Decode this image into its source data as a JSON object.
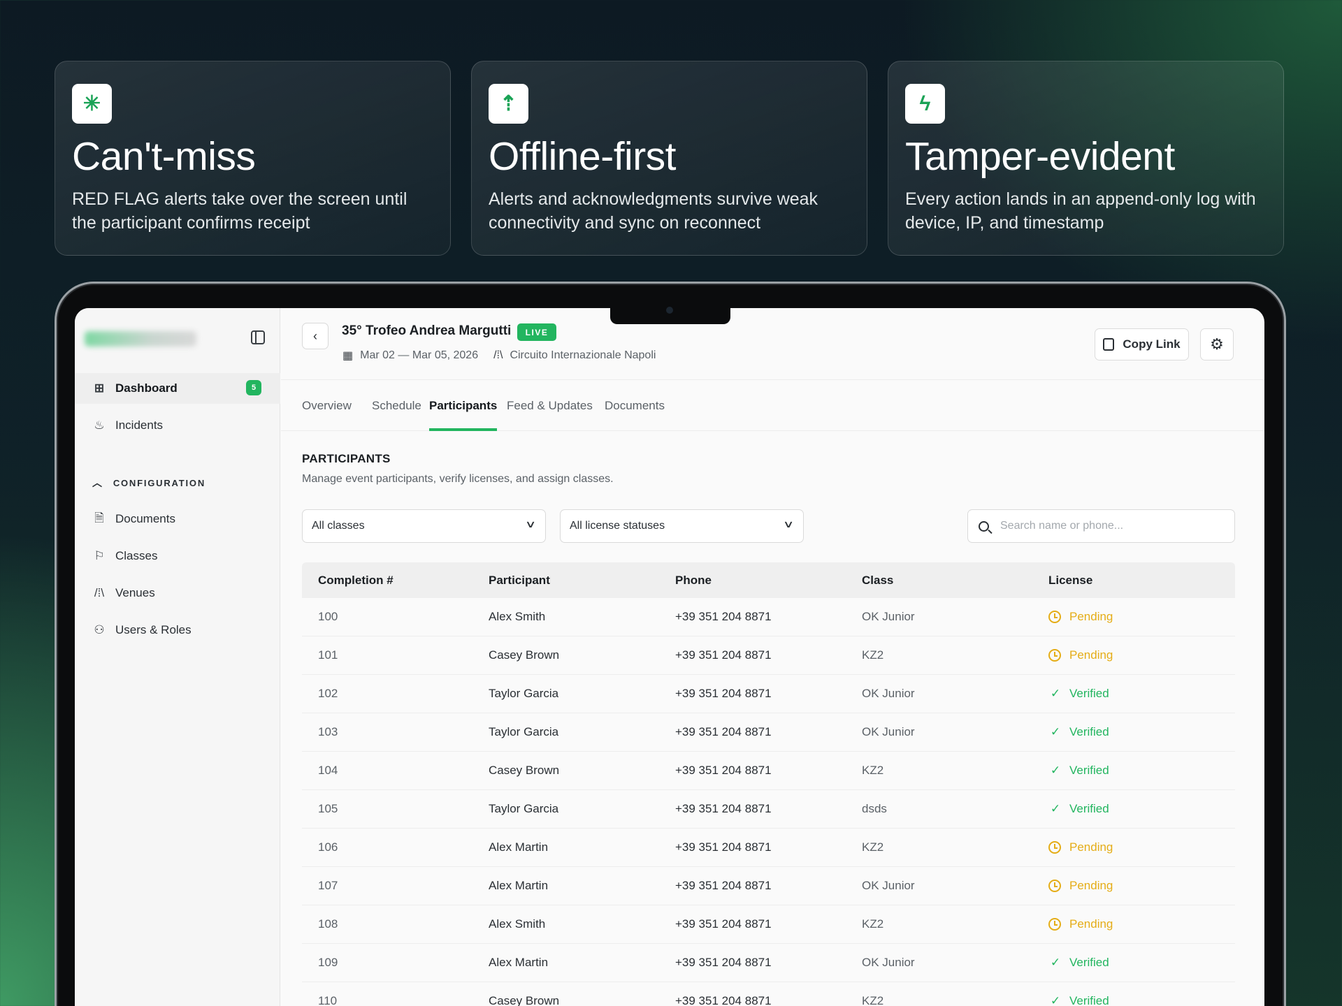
{
  "features": [
    {
      "icon": "asterisk-icon",
      "title": "Can't-miss",
      "desc": "RED FLAG alerts take over the screen until the participant confirms receipt"
    },
    {
      "icon": "arrow-up-icon",
      "title": "Offline-first",
      "desc": "Alerts and acknowledgments survive weak connectivity and sync on reconnect"
    },
    {
      "icon": "bolt-icon",
      "title": "Tamper-evident",
      "desc": "Every action lands in an append-only log with device, IP, and timestamp"
    }
  ],
  "sidebar": {
    "items": [
      {
        "label": "Dashboard",
        "icon": "grid-icon",
        "badge": "5",
        "active": true
      },
      {
        "label": "Incidents",
        "icon": "flame-icon"
      }
    ],
    "section_label": "CONFIGURATION",
    "config_items": [
      {
        "label": "Documents",
        "icon": "document-icon"
      },
      {
        "label": "Classes",
        "icon": "flag-icon"
      },
      {
        "label": "Venues",
        "icon": "road-icon"
      },
      {
        "label": "Users & Roles",
        "icon": "users-icon"
      }
    ]
  },
  "event": {
    "title": "35° Trofeo Andrea Margutti",
    "status": "LIVE",
    "dates": "Mar 02 — Mar 05, 2026",
    "venue": "Circuito Internazionale Napoli"
  },
  "header": {
    "copy_label": "Copy Link"
  },
  "tabs": [
    "Overview",
    "Schedule",
    "Participants",
    "Feed & Updates",
    "Documents"
  ],
  "active_tab": "Participants",
  "participants": {
    "title": "PARTICIPANTS",
    "subtitle": "Manage event participants, verify licenses, and assign classes.",
    "filter_class": "All classes",
    "filter_license": "All license statuses",
    "search_placeholder": "Search name or phone...",
    "columns": [
      "Completion #",
      "Participant",
      "Phone",
      "Class",
      "License"
    ],
    "rows": [
      {
        "num": "100",
        "name": "Alex Smith",
        "phone": "+39 351 204 8871",
        "cls": "OK Junior",
        "license": "Pending"
      },
      {
        "num": "101",
        "name": "Casey Brown",
        "phone": "+39 351 204 8871",
        "cls": "KZ2",
        "license": "Pending"
      },
      {
        "num": "102",
        "name": "Taylor Garcia",
        "phone": "+39 351 204 8871",
        "cls": "OK Junior",
        "license": "Verified"
      },
      {
        "num": "103",
        "name": "Taylor Garcia",
        "phone": "+39 351 204 8871",
        "cls": "OK Junior",
        "license": "Verified"
      },
      {
        "num": "104",
        "name": "Casey Brown",
        "phone": "+39 351 204 8871",
        "cls": "KZ2",
        "license": "Verified"
      },
      {
        "num": "105",
        "name": "Taylor Garcia",
        "phone": "+39 351 204 8871",
        "cls": "dsds",
        "license": "Verified"
      },
      {
        "num": "106",
        "name": "Alex Martin",
        "phone": "+39 351 204 8871",
        "cls": "KZ2",
        "license": "Pending"
      },
      {
        "num": "107",
        "name": "Alex Martin",
        "phone": "+39 351 204 8871",
        "cls": "OK Junior",
        "license": "Pending"
      },
      {
        "num": "108",
        "name": "Alex Smith",
        "phone": "+39 351 204 8871",
        "cls": "KZ2",
        "license": "Pending"
      },
      {
        "num": "109",
        "name": "Alex Martin",
        "phone": "+39 351 204 8871",
        "cls": "OK Junior",
        "license": "Verified"
      },
      {
        "num": "110",
        "name": "Casey Brown",
        "phone": "+39 351 204 8871",
        "cls": "KZ2",
        "license": "Verified"
      }
    ]
  },
  "colors": {
    "accent": "#22b55f",
    "pending": "#e5ad17"
  }
}
